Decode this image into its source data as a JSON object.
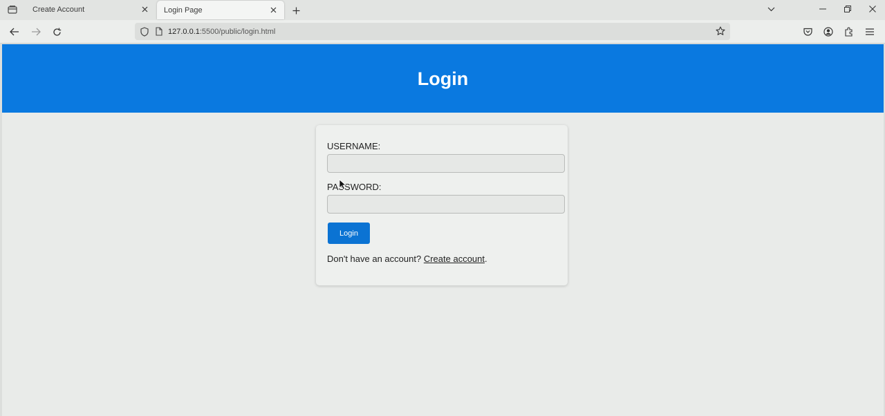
{
  "browser": {
    "tabs": [
      {
        "label": "Create Account",
        "active": false
      },
      {
        "label": "Login Page",
        "active": true
      }
    ],
    "url": {
      "host": "127.0.0.1",
      "rest": ":5500/public/login.html"
    },
    "icons": {
      "tab_list": "tab-list-icon",
      "close": "close-icon",
      "new_tab": "plus-icon",
      "back": "back-arrow-icon",
      "forward": "forward-arrow-icon",
      "reload": "reload-icon",
      "tracking": "shield-icon",
      "page": "page-icon",
      "bookmark": "star-icon",
      "pocket": "pocket-icon",
      "account": "account-icon",
      "extensions": "puzzle-icon",
      "menu": "hamburger-menu-icon"
    }
  },
  "page": {
    "header_title": "Login",
    "form": {
      "username_label": "USERNAME:",
      "username_value": "",
      "password_label": "PASSWORD:",
      "password_value": "",
      "login_button": "Login",
      "signup_prompt": "Don't have an account?",
      "signup_link": "Create account",
      "signup_suffix": "."
    }
  },
  "colors": {
    "header_bg": "#0a79e0",
    "button_bg": "#0b73d3",
    "page_bg": "#e9ebe9",
    "card_bg": "#eef0ee"
  }
}
